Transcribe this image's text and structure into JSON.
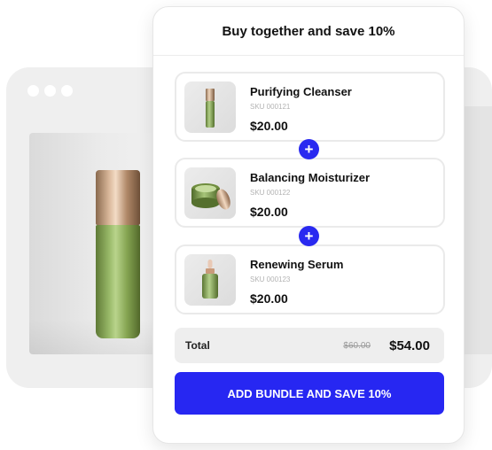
{
  "bundle": {
    "title": "Buy together and save 10%",
    "items": [
      {
        "name": "Purifying Cleanser",
        "sku": "SKU 000121",
        "price": "$20.00",
        "image_icon": "cleanser-bottle-icon"
      },
      {
        "name": "Balancing Moisturizer",
        "sku": "SKU 000122",
        "price": "$20.00",
        "image_icon": "moisturizer-jar-icon"
      },
      {
        "name": "Renewing Serum",
        "sku": "SKU 000123",
        "price": "$20.00",
        "image_icon": "serum-dropper-icon"
      }
    ],
    "plus_symbol": "+",
    "total": {
      "label": "Total",
      "original_price": "$60.00",
      "bundle_price": "$54.00"
    },
    "cta_label": "ADD BUNDLE AND SAVE 10%"
  },
  "colors": {
    "accent": "#2727f2",
    "product_green": "#8fb05a",
    "cap_gold": "#d9b79a"
  }
}
